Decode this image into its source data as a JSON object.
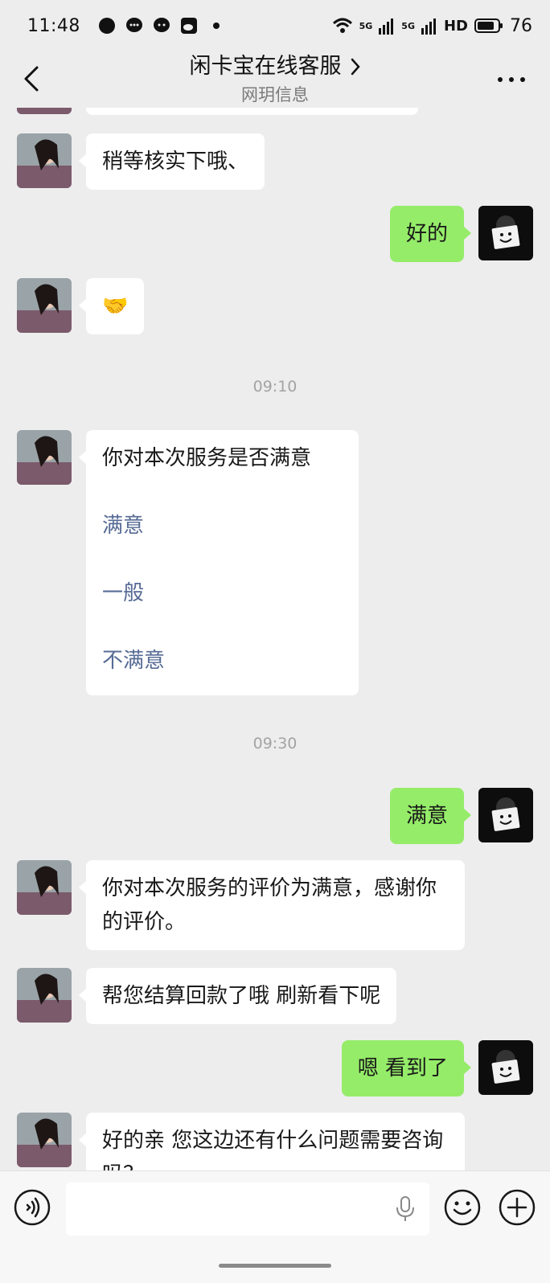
{
  "status_bar": {
    "time": "11:48",
    "network_1": "5G",
    "network_2": "5G",
    "hd": "HD",
    "battery": "76"
  },
  "header": {
    "title": "闲卡宝在线客服",
    "subtitle": "网玥信息"
  },
  "messages": {
    "m1": "稍等核实下哦、",
    "m2": "好的",
    "m3": "🤝",
    "t1": "09:10",
    "survey": {
      "question": "你对本次服务是否满意",
      "option1": "满意",
      "option2": "一般",
      "option3": "不满意"
    },
    "t2": "09:30",
    "m4": "满意",
    "m5": "你对本次服务的评价为满意，感谢你的评价。",
    "m6": "帮您结算回款了哦 刷新看下呢",
    "m7": "嗯 看到了",
    "m8": "好的亲   您这边还有什么问题需要咨询吗？"
  },
  "colors": {
    "background": "#ededed",
    "my_bubble": "#95ec69",
    "their_bubble": "#ffffff",
    "link": "#576b95"
  }
}
